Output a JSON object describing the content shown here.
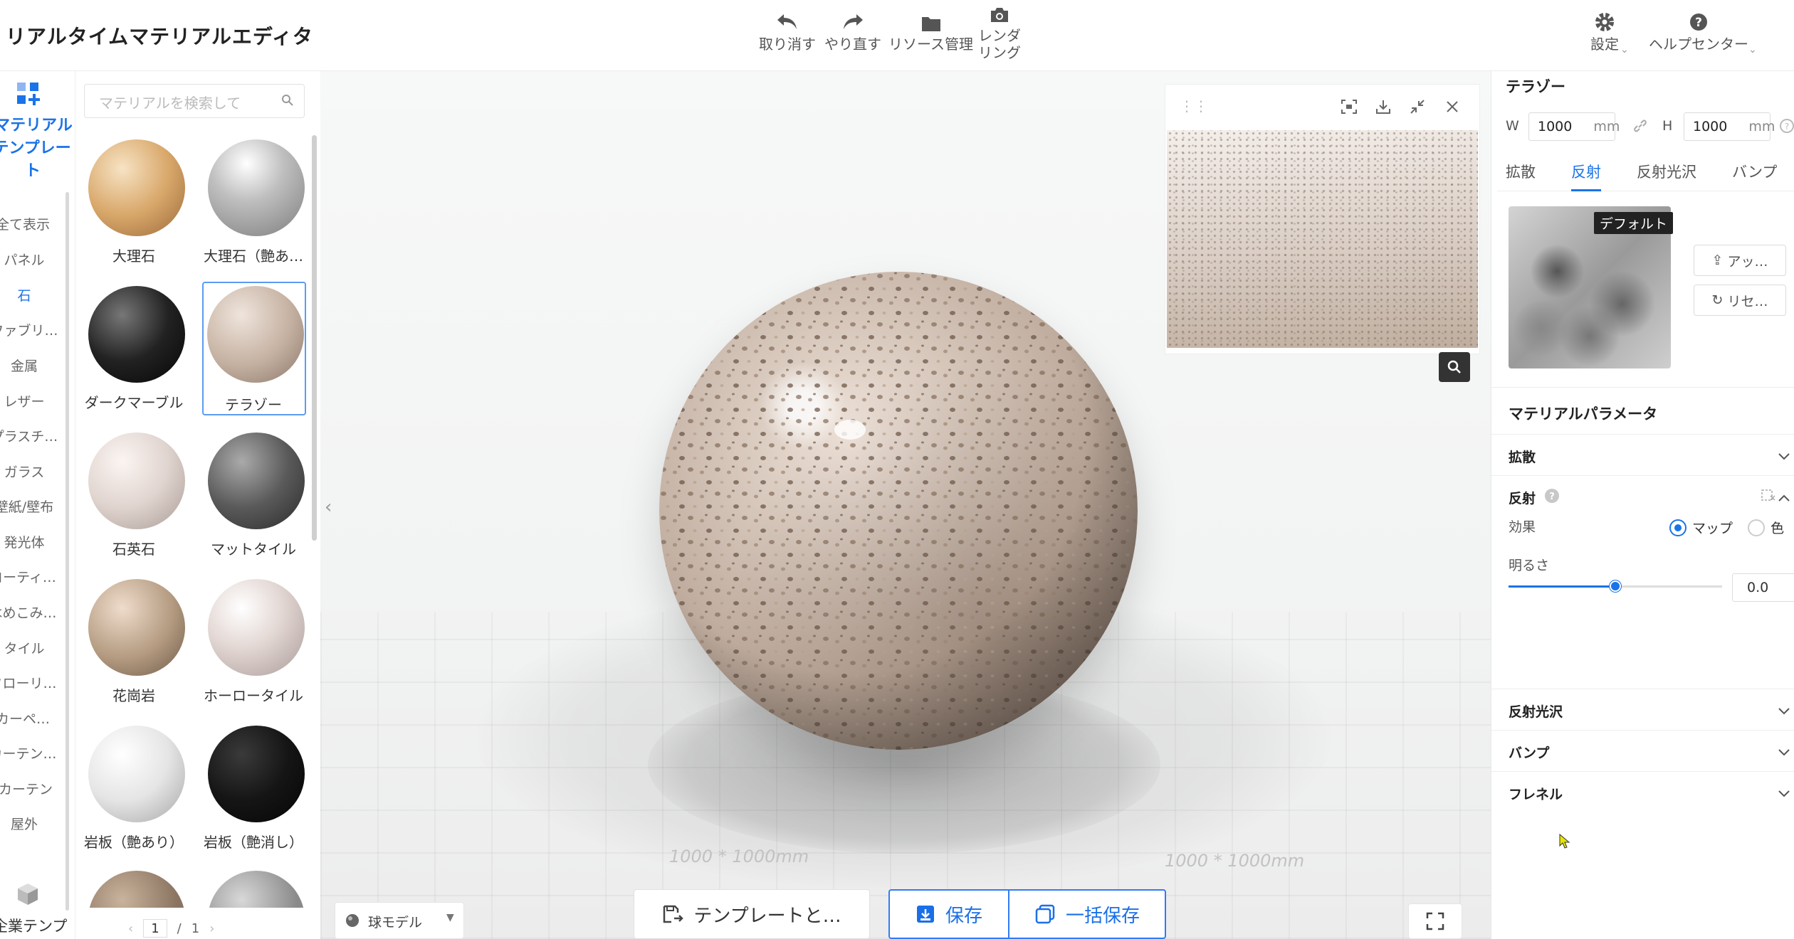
{
  "app": {
    "title": "リアルタイムマテリアルエディタ"
  },
  "toolbar": {
    "undo": "取り消す",
    "redo": "やり直す",
    "resources": "リソース管理",
    "render_line1": "レンダ",
    "render_line2": "リング",
    "settings": "設定",
    "help": "ヘルプセンター"
  },
  "categories": {
    "header_line1": "マテリアル",
    "header_line2": "テンプレー",
    "header_line3": "ト",
    "items": [
      "全て表示",
      "パネル",
      "石",
      "ファブリ…",
      "金属",
      "レザー",
      "プラスチ…",
      "ガラス",
      "壁紙/壁布",
      "発光体",
      "コーティ…",
      "はめこみ…",
      "タイル",
      "フローリ…",
      "カーペ…",
      "カーテン…",
      "カーテン",
      "屋外"
    ],
    "active": "石",
    "footer": "企業テンプ"
  },
  "search": {
    "placeholder": "マテリアルを検索して"
  },
  "materials": [
    {
      "label": "大理石"
    },
    {
      "label": "大理石（艶あ…"
    },
    {
      "label": "ダークマーブル"
    },
    {
      "label": "テラゾー"
    },
    {
      "label": "石英石"
    },
    {
      "label": "マットタイル"
    },
    {
      "label": "花崗岩"
    },
    {
      "label": "ホーロータイル"
    },
    {
      "label": "岩板（艶あり）"
    },
    {
      "label": "岩板（艶消し）"
    }
  ],
  "selected_material": "テラゾー",
  "pager": {
    "current": "1",
    "sep": "/",
    "total": "1"
  },
  "viewport": {
    "floor_label_left": "1000 * 1000mm",
    "floor_label_right": "1000 * 1000mm",
    "model_select": "球モデル"
  },
  "actions": {
    "template": "テンプレートと…",
    "save": "保存",
    "bulk_save": "一括保存"
  },
  "panel": {
    "material_name": "テラゾー",
    "w_label": "W",
    "w_value": "1000",
    "h_label": "H",
    "h_value": "1000",
    "unit": "mm",
    "tabs": [
      "拡散",
      "反射",
      "反射光沢",
      "バンプ"
    ],
    "active_tab": "反射",
    "texture_tag": "デフォルト",
    "upload_btn": "アッ…",
    "reset_btn": "リセ…",
    "params_title": "マテリアルパラメータ",
    "sections": {
      "diffuse": "拡散",
      "reflection": "反射",
      "gloss": "反射光沢",
      "bump": "バンプ",
      "fresnel": "フレネル"
    },
    "effect_label": "効果",
    "opt_map": "マップ",
    "opt_color": "色",
    "effect_selected": "マップ",
    "brightness_label": "明るさ",
    "brightness_value": "0.0",
    "brightness_fraction": 0.5
  },
  "colors": {
    "accent": "#1a73e8"
  }
}
